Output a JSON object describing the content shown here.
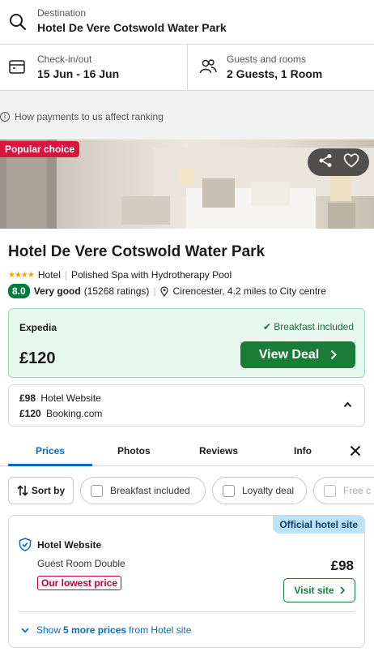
{
  "search": {
    "destination_label": "Destination",
    "destination_value": "Hotel De Vere Cotswold Water Park",
    "dates_label": "Check-in/out",
    "dates_value": "15 Jun - 16 Jun",
    "guests_label": "Guests and rooms",
    "guests_value": "2 Guests, 1 Room"
  },
  "ranking_note": "How payments to us affect ranking",
  "hotel": {
    "badge": "Popular choice",
    "name": "Hotel De Vere Cotswold Water Park",
    "stars": "★★★★",
    "star_count": 4,
    "type": "Hotel",
    "highlight": "Polished Spa with Hydrotherapy Pool",
    "score": "8.0",
    "rating_text": "Very good",
    "ratings_count": "(15268 ratings)",
    "location": "Cirencester, 4.2 miles to City centre"
  },
  "deal": {
    "provider": "Expedia",
    "breakfast": "Breakfast included",
    "price": "£120",
    "cta": "View Deal"
  },
  "other_prices": [
    {
      "price": "£98",
      "provider": "Hotel Website"
    },
    {
      "price": "£120",
      "provider": "Booking.com"
    }
  ],
  "tabs": [
    {
      "label": "Prices",
      "active": true
    },
    {
      "label": "Photos",
      "active": false
    },
    {
      "label": "Reviews",
      "active": false
    },
    {
      "label": "Info",
      "active": false
    }
  ],
  "filters": {
    "sort_label": "Sort by",
    "chips": [
      "Breakfast included",
      "Loyalty deal",
      "Free c"
    ]
  },
  "official": {
    "badge": "Official hotel site",
    "provider": "Hotel Website",
    "room": "Guest Room Double",
    "lowest_tag": "Our lowest price",
    "price": "£98",
    "cta": "Visit site",
    "more_prefix": "Show",
    "more_count": "5 more prices",
    "more_suffix": "from Hotel site"
  },
  "colors": {
    "accent_blue": "#0b68c4",
    "deal_green": "#1a7d37",
    "score_green": "#007a3d",
    "popular_red": "#d6163f",
    "lowest_red": "#c00033",
    "official_badge_bg": "#bde2fb"
  },
  "icons": {
    "destination": "search-icon",
    "dates": "calendar-icon",
    "guests": "people-icon",
    "share": "share-icon",
    "favorite": "heart-icon",
    "location": "map-pin-icon",
    "collapse": "chevron-up-icon",
    "close": "close-icon",
    "sort": "sort-arrows-icon",
    "official": "shield-check-icon"
  }
}
